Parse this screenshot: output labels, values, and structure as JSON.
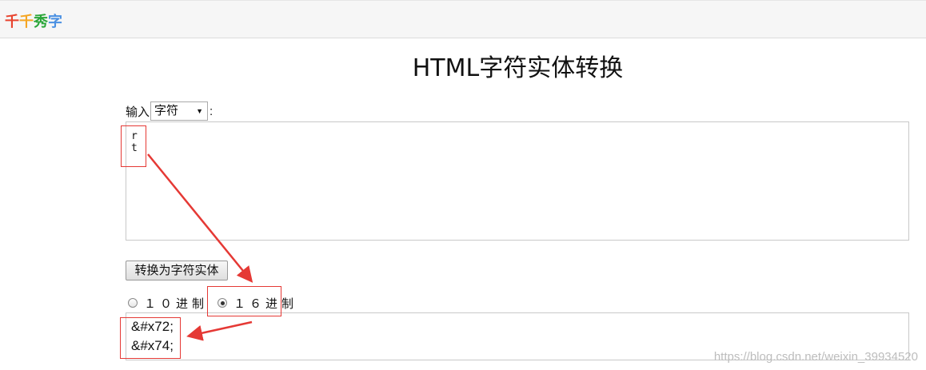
{
  "header": {
    "logo_chars": [
      {
        "char": "千",
        "color": "#e8432e"
      },
      {
        "char": "千",
        "color": "#f5a623"
      },
      {
        "char": "秀",
        "color": "#2aa639"
      },
      {
        "char": "字",
        "color": "#4a90e2"
      }
    ]
  },
  "main": {
    "title": "HTML字符实体转换",
    "input_label": "输入",
    "input_colon": ":",
    "input_type_select": {
      "selected": "字符"
    },
    "input_text_lines": [
      "r",
      "t"
    ],
    "convert_button": "转换为字符实体",
    "radio_options": [
      {
        "label": "１０进制",
        "checked": false
      },
      {
        "label": "１６进制",
        "checked": true
      }
    ],
    "output_text_lines": [
      "&#x72;",
      "&#x74;"
    ]
  },
  "annotation_color": "#e53935",
  "watermark": "https://blog.csdn.net/weixin_39934520"
}
